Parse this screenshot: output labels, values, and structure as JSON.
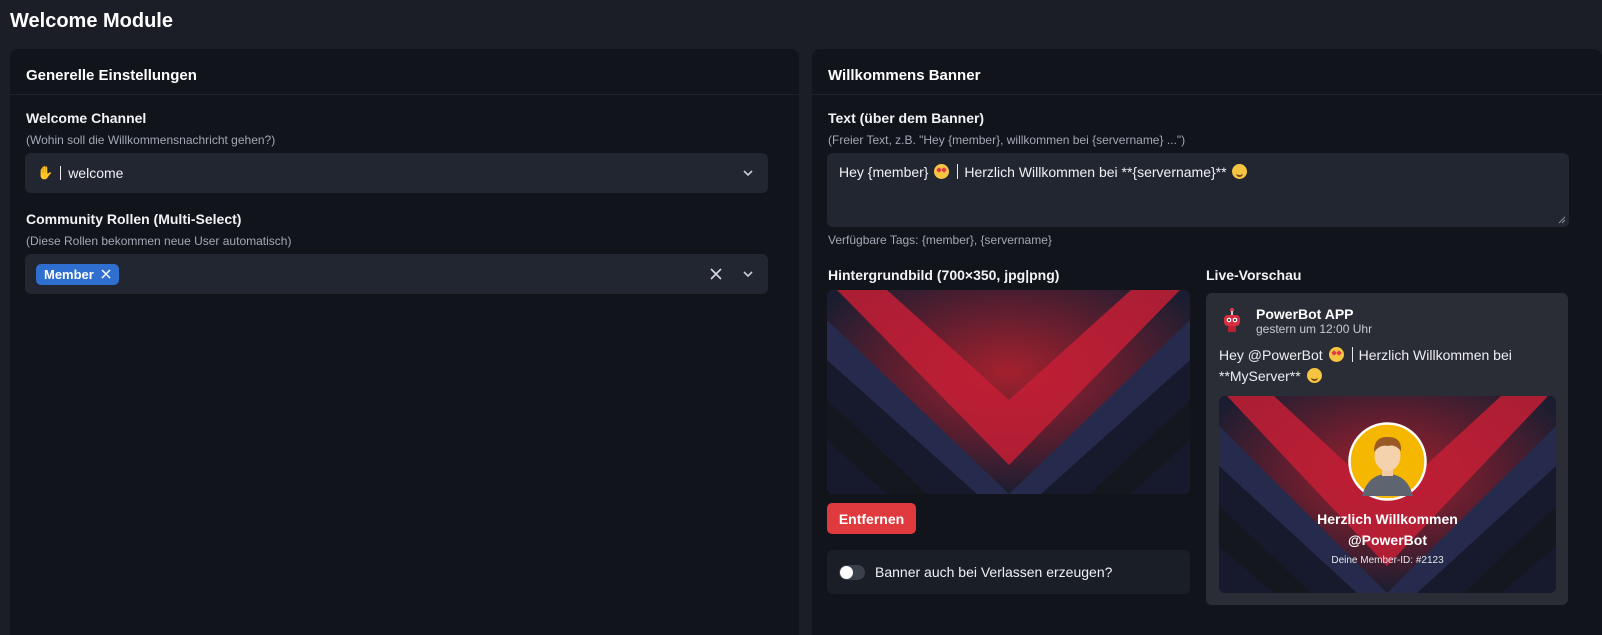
{
  "page": {
    "title": "Welcome Module"
  },
  "general": {
    "heading": "Generelle Einstellungen",
    "channel": {
      "label": "Welcome Channel",
      "hint": "(Wohin soll die Willkommensnachricht gehen?)",
      "value": "welcome",
      "icon": "waving-hand-icon"
    },
    "roles": {
      "label": "Community Rollen (Multi-Select)",
      "hint": "(Diese Rollen bekommen neue User automatisch)",
      "tags": [
        "Member"
      ]
    }
  },
  "banner": {
    "heading": "Willkommens Banner",
    "text_field": {
      "label": "Text (über dem Banner)",
      "hint": "(Freier Text, z.B. \"Hey {member}, willkommen bei {servername} ...\")",
      "value_prefix": "Hey {member}",
      "value_suffix": "Herzlich Willkommen bei **{servername}**",
      "tags_hint": "Verfügbare Tags: {member}, {servername}"
    },
    "background": {
      "label": "Hintergrundbild (700×350, jpg|png)",
      "remove_label": "Entfernen"
    },
    "leave_toggle": {
      "label": "Banner auch bei Verlassen erzeugen?",
      "on": false
    },
    "preview": {
      "label": "Live-Vorschau",
      "bot_name": "PowerBot APP",
      "timestamp": "gestern um 12:00 Uhr",
      "message_prefix": "Hey @PowerBot",
      "message_suffix": "Herzlich Willkommen bei",
      "message_line2": "**MyServer**",
      "card_line1": "Herzlich Willkommen",
      "card_line2": "@PowerBot",
      "card_member_id": "Deine Member-ID: #2123"
    }
  },
  "colors": {
    "accent_red": "#e03a3e",
    "tag_blue": "#2e6fd0",
    "background": "#1b1e26",
    "card": "#11141b"
  }
}
